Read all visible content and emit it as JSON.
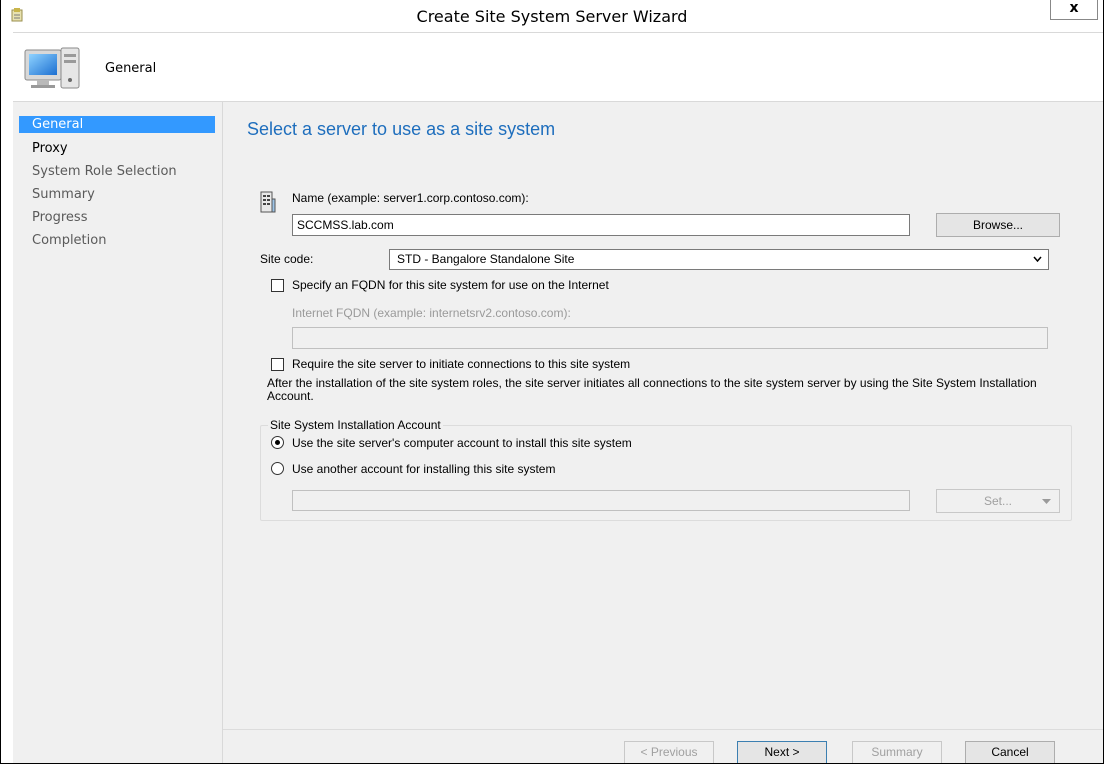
{
  "window": {
    "title": "Create Site System Server Wizard",
    "close_label": "x"
  },
  "header": {
    "title": "General",
    "icon": "computer-icon"
  },
  "nav": {
    "items": [
      {
        "label": "General",
        "state": "active"
      },
      {
        "label": "Proxy",
        "state": "normal"
      },
      {
        "label": "System Role Selection",
        "state": "normal"
      },
      {
        "label": "Summary",
        "state": "normal"
      },
      {
        "label": "Progress",
        "state": "normal"
      },
      {
        "label": "Completion",
        "state": "normal"
      }
    ]
  },
  "main": {
    "heading": "Select a server to use as a site system",
    "name_label": "Name (example: server1.corp.contoso.com):",
    "name_value": "SCCMSS.lab.com",
    "browse_label": "Browse...",
    "site_code_label": "Site code:",
    "site_code_value": "STD - Bangalore Standalone Site",
    "fqdn_checkbox_label": "Specify an FQDN for this site system for use on the Internet",
    "fqdn_checked": false,
    "internet_fqdn_label": "Internet FQDN (example: internetsrv2.contoso.com):",
    "internet_fqdn_value": "",
    "require_checkbox_label": "Require the site server to initiate connections to this site system",
    "require_checked": false,
    "info_text": "After the  installation of the site system roles, the site server initiates all connections to the site system server by using the Site System Installation Account.",
    "install_account": {
      "legend": "Site System Installation Account",
      "option1_label": "Use the site server's computer account to install this site system",
      "option2_label": "Use another account for installing this site system",
      "selected": "option1",
      "account_value": "",
      "set_label": "Set..."
    }
  },
  "footer": {
    "previous_label": "< Previous",
    "next_label": "Next >",
    "summary_label": "Summary",
    "cancel_label": "Cancel"
  },
  "colors": {
    "accent": "#3399ff",
    "heading": "#1e6ebd",
    "panel": "#f0f0f0"
  }
}
